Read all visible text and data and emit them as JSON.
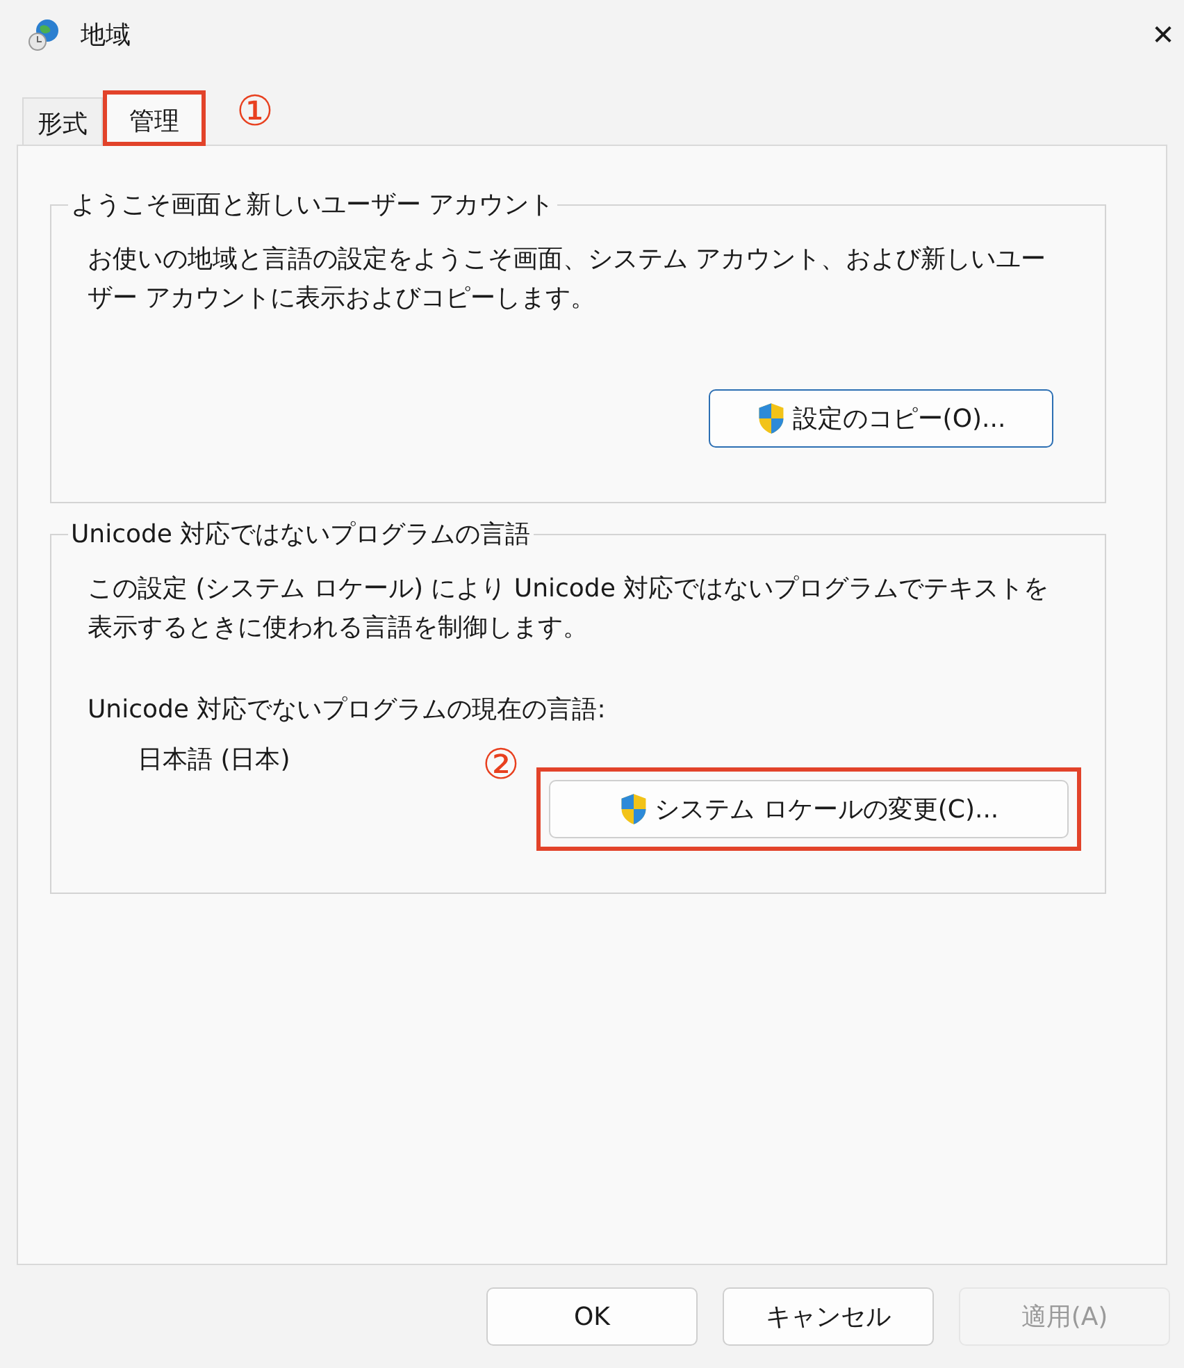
{
  "window": {
    "title": "地域",
    "close": "✕"
  },
  "tabs": [
    {
      "label": "形式",
      "selected": false,
      "highlighted": false
    },
    {
      "label": "管理",
      "selected": true,
      "highlighted": true
    }
  ],
  "tab_callout": "①",
  "groups": [
    {
      "title": "ようこそ画面と新しいユーザー アカウント",
      "description": "お使いの地域と言語の設定をようこそ画面、システム アカウント、および新しいユーザー アカウントに表示およびコピーします。",
      "button": {
        "label": "設定のコピー(O)...",
        "highlighted": false
      }
    },
    {
      "title": "Unicode 対応ではないプログラムの言語",
      "description": "この設定 (システム ロケール) により Unicode 対応ではないプログラムでテキストを表示するときに使われる言語を制御します。",
      "current_label": "Unicode 対応でないプログラムの現在の言語:",
      "current_value": "日本語 (日本)",
      "callout": "②",
      "button": {
        "label": "システム ロケールの変更(C)...",
        "highlighted": true
      }
    }
  ],
  "buttons": [
    {
      "label": "OK",
      "disabled": false
    },
    {
      "label": "キャンセル",
      "disabled": false
    },
    {
      "label": "適用(A)",
      "disabled": true
    }
  ]
}
